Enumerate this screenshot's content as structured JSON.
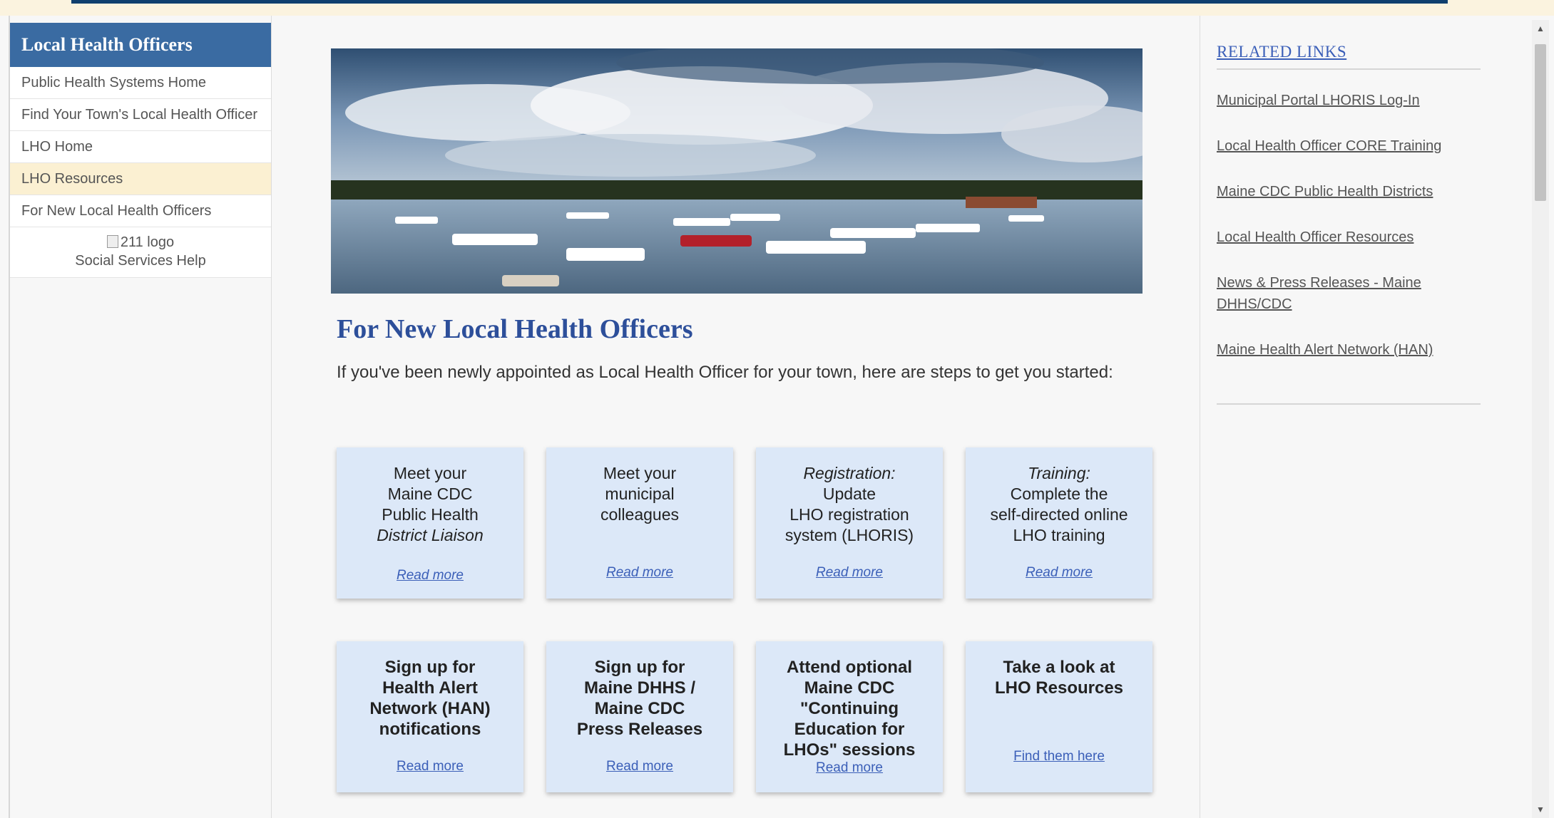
{
  "sidebar": {
    "title": "Local Health Officers",
    "items": [
      {
        "label": "Public Health Systems Home",
        "active": false
      },
      {
        "label": "Find Your Town's Local Health Officer",
        "active": false
      },
      {
        "label": "LHO Home",
        "active": false
      },
      {
        "label": "LHO Resources",
        "active": true
      },
      {
        "label": "For New Local Health Officers",
        "active": false
      }
    ],
    "logo_alt": "211 logo",
    "social_help": "Social Services Help"
  },
  "main": {
    "title": "For New Local Health Officers",
    "intro": "If you've been newly appointed as Local Health Officer for your town, here are steps to get you started:",
    "cards_row1": [
      {
        "text_lines": [
          "Meet your",
          "Maine CDC",
          "Public Health"
        ],
        "italic_line": "District Liaison",
        "link": "Read more"
      },
      {
        "text_lines": [
          "Meet your",
          "municipal",
          "colleagues"
        ],
        "italic_line": "",
        "link": "Read more"
      },
      {
        "italic_line": "Registration:",
        "text_lines": [
          "Update",
          "LHO registration",
          "system (LHORIS)"
        ],
        "link": "Read more"
      },
      {
        "italic_line": "Training:",
        "text_lines": [
          "Complete the",
          "self-directed online",
          "LHO training"
        ],
        "link": "Read more"
      }
    ],
    "cards_row2": [
      {
        "text": "Sign up for\nHealth Alert\nNetwork (HAN)\nnotifications",
        "link": "Read more"
      },
      {
        "text": "Sign up for\nMaine DHHS /\nMaine CDC\nPress Releases",
        "link": "Read more"
      },
      {
        "text": "Attend optional\nMaine CDC\n\"Continuing\nEducation for\nLHOs\" sessions",
        "link": "Read more"
      },
      {
        "text": "Take a look at\nLHO Resources",
        "link": "Find them here"
      }
    ]
  },
  "related": {
    "title": "RELATED LINKS",
    "links": [
      "Municipal Portal LHORIS Log-In",
      "Local Health Officer CORE Training",
      "Maine CDC Public Health Districts",
      "Local Health Officer Resources",
      "News & Press Releases - Maine DHHS/CDC",
      "Maine Health Alert Network (HAN)"
    ]
  },
  "colors": {
    "header_blue": "#3a6ba2",
    "active_item": "#fbf0d2",
    "card_bg": "#dce8f8",
    "title_blue": "#2d4f9a",
    "link_blue": "#3b5fb8"
  }
}
